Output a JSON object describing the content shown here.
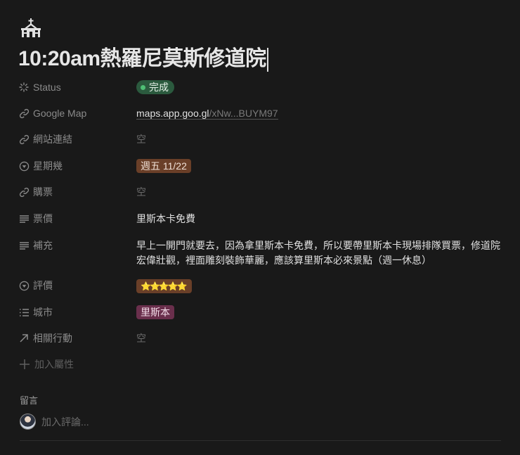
{
  "page": {
    "icon": "church-icon",
    "title": "10:20am熱羅尼莫斯修道院"
  },
  "properties": [
    {
      "label": "Status",
      "icon": "status-spinner-icon",
      "value": "完成",
      "type": "status"
    },
    {
      "label": "Google Map",
      "icon": "link-icon",
      "value_main": "maps.app.goo.gl",
      "value_rest": "/xNw...BUYM97",
      "type": "url"
    },
    {
      "label": "網站連結",
      "icon": "link-icon",
      "value": "空",
      "type": "empty"
    },
    {
      "label": "星期幾",
      "icon": "select-icon",
      "value": "週五 11/22",
      "type": "select"
    },
    {
      "label": "購票",
      "icon": "link-icon",
      "value": "空",
      "type": "empty"
    },
    {
      "label": "票價",
      "icon": "text-icon",
      "value": "里斯本卡免費",
      "type": "text"
    },
    {
      "label": "補充",
      "icon": "text-icon",
      "value": "早上一開門就要去，因為拿里斯本卡免費，所以要帶里斯本卡現場排隊買票，修道院宏偉壯觀，裡面雕刻裝飾華麗，應該算里斯本必來景點（週一休息）",
      "type": "text"
    },
    {
      "label": "評價",
      "icon": "select-icon",
      "value": "⭐⭐⭐⭐⭐",
      "type": "select"
    },
    {
      "label": "城市",
      "icon": "multiselect-icon",
      "value": "里斯本",
      "type": "multiselect"
    },
    {
      "label": "相關行動",
      "icon": "relation-arrow-icon",
      "value": "空",
      "type": "empty"
    }
  ],
  "add_property_label": "加入屬性",
  "comments": {
    "heading": "留言",
    "placeholder": "加入評論..."
  },
  "colors": {
    "background": "#191919",
    "status_green": "#2b5a3e",
    "brown_tag": "#6a3f28",
    "purple_tag": "#6a2f4c"
  }
}
